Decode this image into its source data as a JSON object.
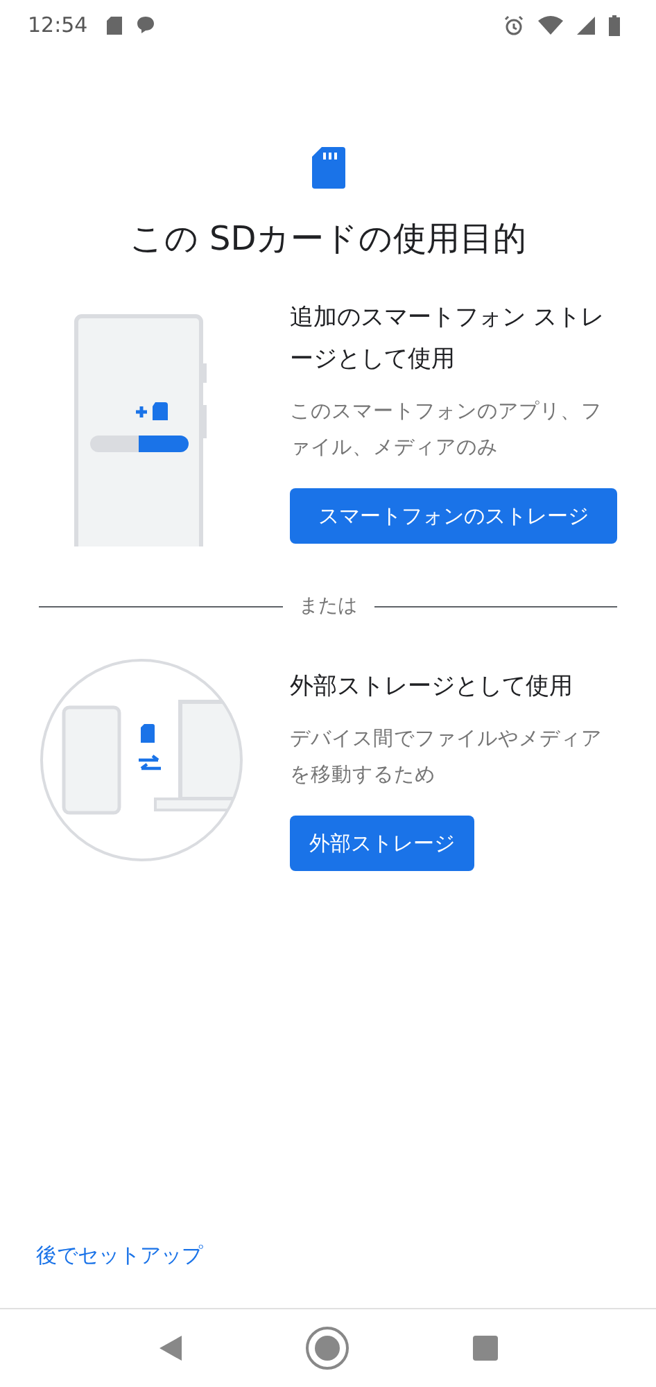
{
  "status_bar": {
    "time": "12:54"
  },
  "title": "この SDカードの使用目的",
  "options": [
    {
      "kind": "internal",
      "heading": "追加のスマートフォン ストレージとして使用",
      "description": "このスマートフォンのアプリ、ファイル、メディアのみ",
      "button": "スマートフォンのストレージ"
    },
    {
      "kind": "portable",
      "heading": "外部ストレージとして使用",
      "description": "デバイス間でファイルやメディアを移動するため",
      "button": "外部ストレージ"
    }
  ],
  "separator": "または",
  "later_link": "後でセットアップ"
}
